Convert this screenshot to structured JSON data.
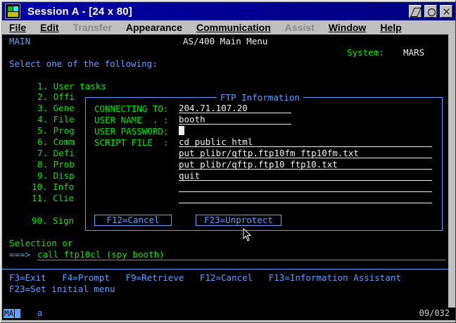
{
  "window": {
    "title": "Session A - [24 x 80]"
  },
  "menu": [
    {
      "label": "File",
      "enabled": true
    },
    {
      "label": "Edit",
      "enabled": true
    },
    {
      "label": "Transfer",
      "enabled": false
    },
    {
      "label": "Appearance",
      "enabled": true
    },
    {
      "label": "Communication",
      "enabled": true
    },
    {
      "label": "Assist",
      "enabled": false
    },
    {
      "label": "Window",
      "enabled": true
    },
    {
      "label": "Help",
      "enabled": true
    }
  ],
  "screen": {
    "menu_id": "MAIN",
    "heading": "AS/400 Main Menu",
    "system_label": "System:",
    "system_name": "MARS",
    "prompt": "Select one of the following:",
    "options": [
      "1. User tasks",
      "2. Offi",
      "3. Gene",
      "4. File",
      "5. Prog",
      "6. Comm",
      "7. Defi",
      "8. Prob",
      "9. Disp",
      "10. Info",
      "11. Clie",
      "90. Sign"
    ],
    "selection_label": "Selection or",
    "command_arrow": "===>",
    "command_value": "call ftp10cl (spy booth)",
    "fkeys_line1": "F3=Exit   F4=Prompt   F9=Retrieve   F12=Cancel   F13=Information Assistant",
    "fkeys_line2": "F23=Set initial menu"
  },
  "popup": {
    "title": "FTP Information",
    "connecting_label": "CONNECTING TO:",
    "connecting_value": "204.71.107.20",
    "user_label": "USER NAME  . :",
    "user_value": "booth",
    "password_label": "USER PASSWORD:",
    "password_value": "",
    "script_label": "SCRIPT FILE  :",
    "script_lines": [
      "cd public_html",
      "put plibr/qftp.ftp10fm ftp10fm.txt",
      "put plibr/qftp.ftp10 ftp10.txt",
      "quit",
      "",
      ""
    ],
    "cancel_label": "F12=Cancel",
    "unprotect_label": "F23=Unprotect"
  },
  "statusbar": {
    "ma": "MA",
    "indicator": "a",
    "position": "09/032"
  },
  "colors": {
    "titlebar": "#000080",
    "screen_bg": "#000000",
    "terminal_blue": "#5f9fff",
    "terminal_green": "#00e600",
    "terminal_white": "#f0f0f0"
  }
}
